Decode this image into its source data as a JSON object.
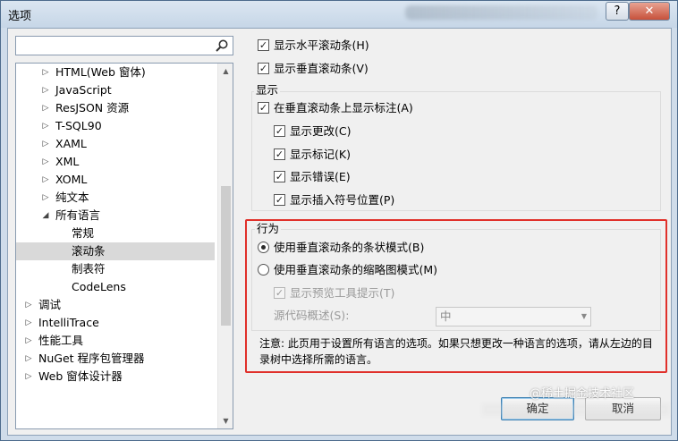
{
  "window": {
    "title": "选项",
    "help_label": "?",
    "close_label": "✕"
  },
  "search": {
    "value": "",
    "placeholder": ""
  },
  "tree": {
    "items": [
      {
        "label": "HTML(Web 窗体)",
        "level": 2,
        "expander": "collapsed"
      },
      {
        "label": "JavaScript",
        "level": 2,
        "expander": "collapsed"
      },
      {
        "label": "ResJSON 资源",
        "level": 2,
        "expander": "collapsed"
      },
      {
        "label": "T-SQL90",
        "level": 2,
        "expander": "collapsed"
      },
      {
        "label": "XAML",
        "level": 2,
        "expander": "collapsed"
      },
      {
        "label": "XML",
        "level": 2,
        "expander": "collapsed"
      },
      {
        "label": "XOML",
        "level": 2,
        "expander": "collapsed"
      },
      {
        "label": "纯文本",
        "level": 2,
        "expander": "collapsed"
      },
      {
        "label": "所有语言",
        "level": 2,
        "expander": "expanded"
      },
      {
        "label": "常规",
        "level": 3,
        "expander": "none"
      },
      {
        "label": "滚动条",
        "level": 3,
        "expander": "none",
        "selected": true
      },
      {
        "label": "制表符",
        "level": 3,
        "expander": "none"
      },
      {
        "label": "CodeLens",
        "level": 3,
        "expander": "none"
      },
      {
        "label": "调试",
        "level": 1,
        "expander": "collapsed"
      },
      {
        "label": "IntelliTrace",
        "level": 1,
        "expander": "collapsed"
      },
      {
        "label": "性能工具",
        "level": 1,
        "expander": "collapsed"
      },
      {
        "label": "NuGet 程序包管理器",
        "level": 1,
        "expander": "collapsed"
      },
      {
        "label": "Web 窗体设计器",
        "level": 1,
        "expander": "collapsed"
      }
    ]
  },
  "options": {
    "show_hscroll": {
      "label": "显示水平滚动条(H)",
      "checked": true
    },
    "show_vscroll": {
      "label": "显示垂直滚动条(V)",
      "checked": true
    },
    "display_group": "显示",
    "show_annotations": {
      "label": "在垂直滚动条上显示标注(A)",
      "checked": true
    },
    "show_changes": {
      "label": "显示更改(C)",
      "checked": true
    },
    "show_marks": {
      "label": "显示标记(K)",
      "checked": true
    },
    "show_errors": {
      "label": "显示错误(E)",
      "checked": true
    },
    "show_caret": {
      "label": "显示插入符号位置(P)",
      "checked": true
    },
    "behavior_group": "行为",
    "bar_mode": {
      "label": "使用垂直滚动条的条状模式(B)",
      "selected": true
    },
    "map_mode": {
      "label": "使用垂直滚动条的缩略图模式(M)",
      "selected": false
    },
    "show_preview": {
      "label": "显示预览工具提示(T)",
      "checked": true,
      "disabled": true
    },
    "source_overview_label": "源代码概述(S):",
    "source_overview_value": "中",
    "note": "注意: 此页用于设置所有语言的选项。如果只想更改一种语言的选项，请从左边的目录树中选择所需的语言。"
  },
  "buttons": {
    "ok": "确定",
    "cancel": "取消"
  },
  "watermark": "@稀土掘金技术社区",
  "glyphs": {
    "check": "✓",
    "collapsed": "▷",
    "expanded": "◢",
    "up": "▲",
    "down": "▼",
    "dropdown": "▼"
  },
  "colors": {
    "highlight_box": "#e0302a",
    "selected_row": "#d9d9d9",
    "default_button_border": "#3c7fb1"
  }
}
